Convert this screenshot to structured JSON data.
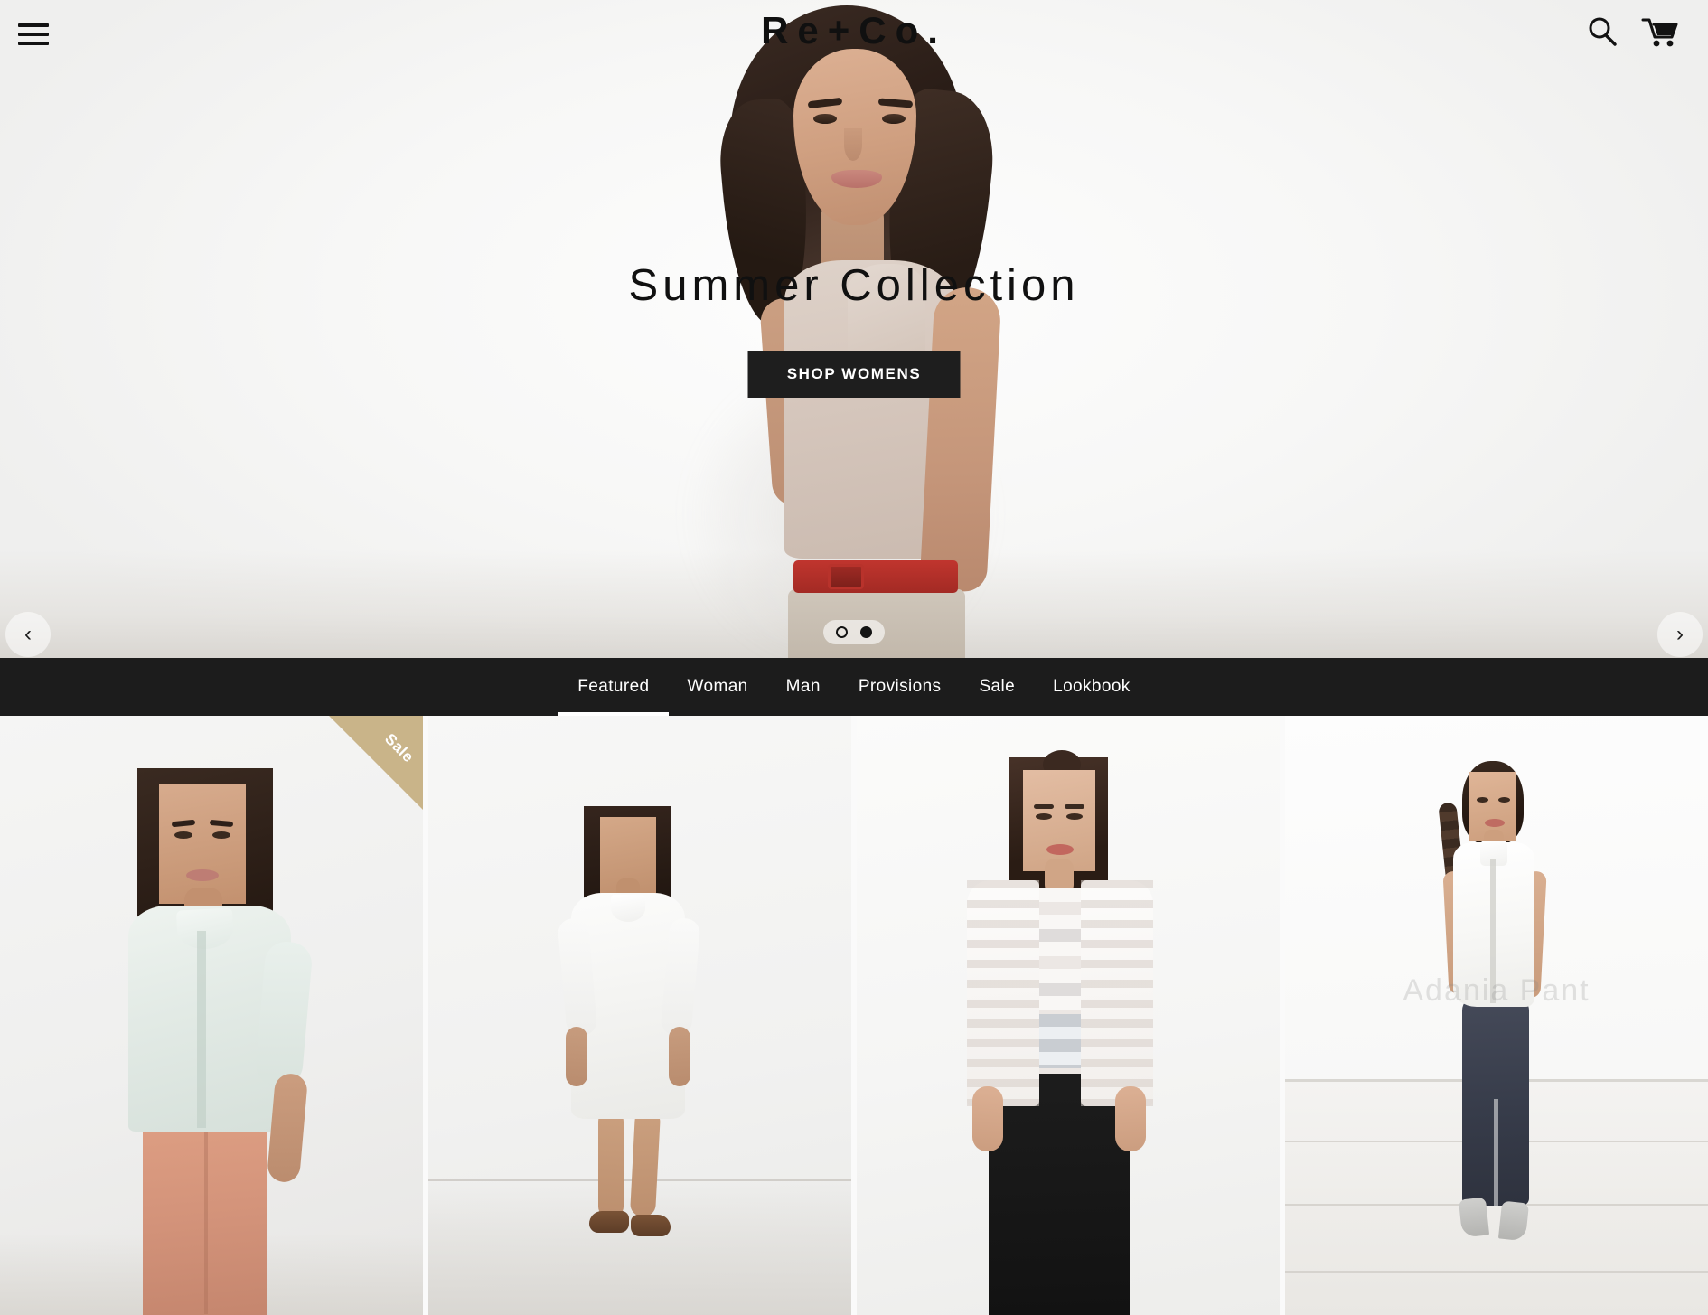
{
  "brand": {
    "logo": "Re+Co."
  },
  "header": {
    "menu_icon": "hamburger-menu-icon",
    "search_icon": "search-icon",
    "cart_icon": "shopping-cart-icon"
  },
  "hero": {
    "title": "Summer Collection",
    "cta_label": "SHOP WOMENS",
    "prev_label": "‹",
    "next_label": "›",
    "slides": [
      {
        "index": 1,
        "active": false
      },
      {
        "index": 2,
        "active": true
      }
    ],
    "active_slide": 2,
    "total_slides": 2
  },
  "nav": {
    "items": [
      {
        "label": "Featured",
        "active": true
      },
      {
        "label": "Woman",
        "active": false
      },
      {
        "label": "Man",
        "active": false
      },
      {
        "label": "Provisions",
        "active": false
      },
      {
        "label": "Sale",
        "active": false
      },
      {
        "label": "Lookbook",
        "active": false
      }
    ]
  },
  "products": [
    {
      "badge": "Sale",
      "alt": "Woman in pale mint button-up shirt and salmon trousers"
    },
    {
      "badge": "",
      "alt": "Woman in white shirt dress with brown flats"
    },
    {
      "badge": "",
      "alt": "Woman in white striped cardigan and black trousers"
    },
    {
      "badge": "",
      "watermark": "Adania Pant",
      "alt": "Woman in white sleeveless blouse and navy leggings with grey heels"
    }
  ],
  "colors": {
    "page_background": "#fafafa",
    "nav_background": "#1c1c1c",
    "cta_background": "#1e1e1e",
    "text_dark": "#101010",
    "text_light": "#ffffff",
    "sale_badge": "#c9b489"
  }
}
